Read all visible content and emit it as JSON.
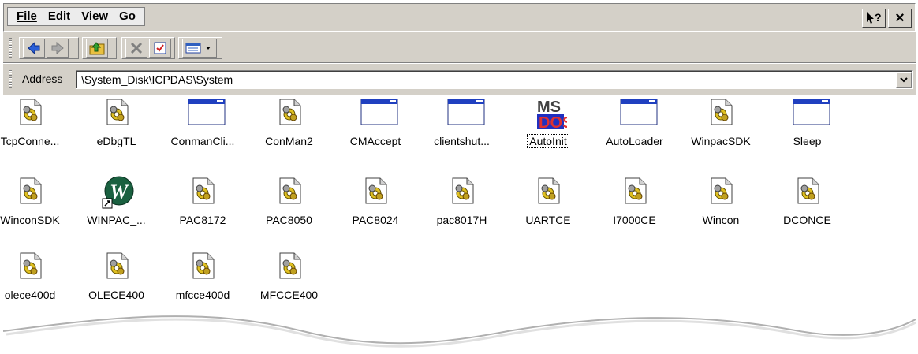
{
  "menu": {
    "items": [
      {
        "label": "File"
      },
      {
        "label": "Edit"
      },
      {
        "label": "View"
      },
      {
        "label": "Go"
      }
    ],
    "help_label": "?",
    "close_label": "×"
  },
  "toolbar": {
    "buttons": [
      "back-icon",
      "forward-icon",
      "up-folder-icon",
      "delete-icon",
      "properties-icon",
      "views-icon"
    ]
  },
  "address": {
    "label": "Address",
    "value": "\\System_Disk\\ICPDAS\\System"
  },
  "files": [
    {
      "name": "TcpConne...",
      "icon": "dll-gear-icon"
    },
    {
      "name": "eDbgTL",
      "icon": "dll-gear-icon"
    },
    {
      "name": "ConmanCli...",
      "icon": "exe-window-icon"
    },
    {
      "name": "ConMan2",
      "icon": "dll-gear-icon"
    },
    {
      "name": "CMAccept",
      "icon": "exe-window-icon"
    },
    {
      "name": "clientshut...",
      "icon": "exe-window-icon"
    },
    {
      "name": "AutoInit",
      "icon": "msdos-icon",
      "focused": true
    },
    {
      "name": "AutoLoader",
      "icon": "exe-window-icon"
    },
    {
      "name": "WinpacSDK",
      "icon": "dll-gear-icon"
    },
    {
      "name": "Sleep",
      "icon": "exe-window-icon"
    },
    {
      "name": "WinconSDK",
      "icon": "dll-gear-icon"
    },
    {
      "name": "WINPAC_...",
      "icon": "winpac-shortcut-icon"
    },
    {
      "name": "PAC8172",
      "icon": "dll-gear-icon"
    },
    {
      "name": "PAC8050",
      "icon": "dll-gear-icon"
    },
    {
      "name": "PAC8024",
      "icon": "dll-gear-icon"
    },
    {
      "name": "pac8017H",
      "icon": "dll-gear-icon"
    },
    {
      "name": "UARTCE",
      "icon": "dll-gear-icon"
    },
    {
      "name": "I7000CE",
      "icon": "dll-gear-icon"
    },
    {
      "name": "Wincon",
      "icon": "dll-gear-icon"
    },
    {
      "name": "DCONCE",
      "icon": "dll-gear-icon"
    },
    {
      "name": "olece400d",
      "icon": "dll-gear-icon"
    },
    {
      "name": "OLECE400",
      "icon": "dll-gear-icon"
    },
    {
      "name": "mfcce400d",
      "icon": "dll-gear-icon"
    },
    {
      "name": "MFCCE400",
      "icon": "dll-gear-icon"
    }
  ]
}
